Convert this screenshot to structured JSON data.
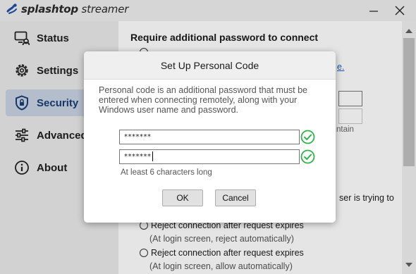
{
  "app": {
    "name_bold": "splashtop",
    "name_light": " streamer"
  },
  "sidebar": {
    "items": [
      {
        "label": "Status",
        "icon": "status-monitor-icon",
        "active": false
      },
      {
        "label": "Settings",
        "icon": "gear-icon",
        "active": false
      },
      {
        "label": "Security",
        "icon": "shield-lock-icon",
        "active": true
      },
      {
        "label": "Advanced",
        "icon": "sliders-icon",
        "active": false
      },
      {
        "label": "About",
        "icon": "info-icon",
        "active": false
      }
    ]
  },
  "content": {
    "heading": "Require additional password to connect",
    "link_fragment": "e.",
    "fragment_ntain": "ntain",
    "fragment_trying": "ser is trying to",
    "options": [
      {
        "label": "Reject connection after request expires",
        "sub": "(At login screen, reject automatically)"
      },
      {
        "label": "Reject connection after request expires",
        "sub": "(At login screen, allow automatically)"
      }
    ]
  },
  "dialog": {
    "title": "Set Up Personal Code",
    "description": "Personal code is an additional password that must be entered when connecting remotely, along with your Windows user name and password.",
    "code_value": "*******",
    "confirm_value": "*******",
    "hint": "At least 6 characters long",
    "ok_label": "OK",
    "cancel_label": "Cancel"
  },
  "colors": {
    "accent": "#1a3e78",
    "active_nav_bg": "#c9d3e2",
    "check_green": "#2eb24a",
    "link": "#1a5fc8"
  }
}
